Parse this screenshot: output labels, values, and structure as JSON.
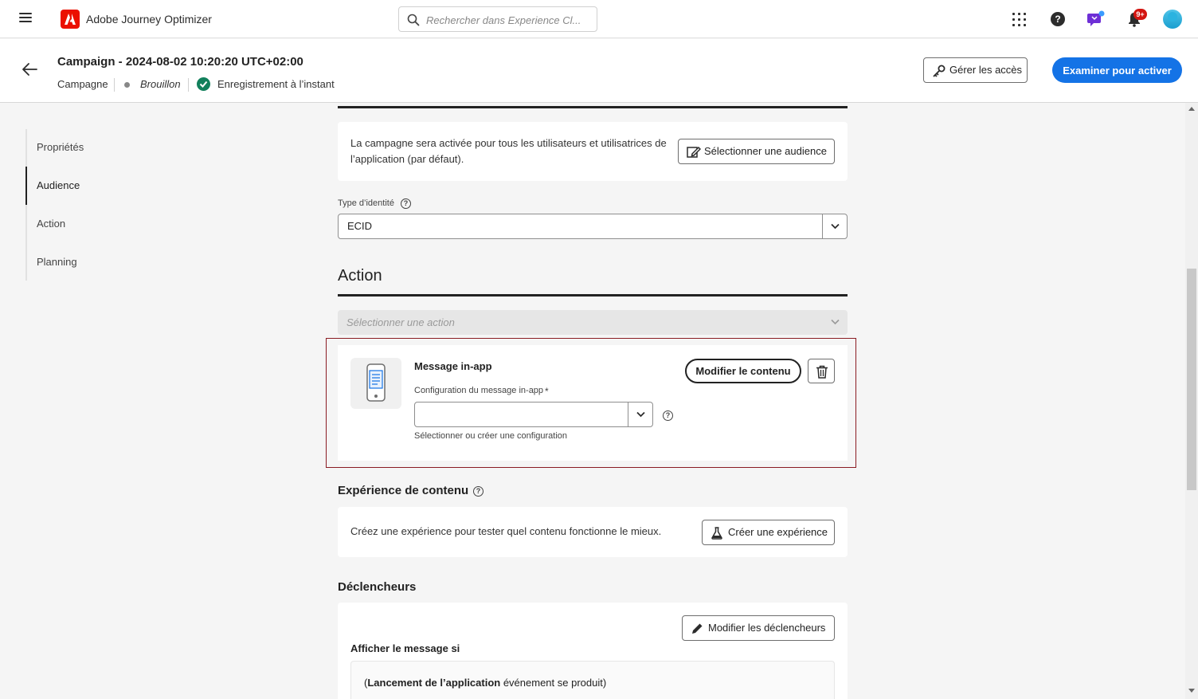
{
  "topbar": {
    "app_title": "Adobe Journey Optimizer",
    "search_placeholder": "Rechercher dans Experience Cl...",
    "notification_badge": "9+"
  },
  "header": {
    "title": "Campaign - 2024-08-02 10:20:20 UTC+02:00",
    "type": "Campagne",
    "status": "Brouillon",
    "save_status": "Enregistrement à l’instant",
    "manage_access_label": "Gérer les accès",
    "review_activate_label": "Examiner pour activer"
  },
  "leftnav": {
    "items": [
      {
        "label": "Propriétés"
      },
      {
        "label": "Audience"
      },
      {
        "label": "Action"
      },
      {
        "label": "Planning"
      }
    ],
    "active": "Audience"
  },
  "audience": {
    "description_line1": "La campagne sera activée pour tous les utilisateurs et utilisatrices de",
    "description_line2": "l’application (par défaut).",
    "select_audience_label": "Sélectionner une audience",
    "identity_type_label": "Type d’identité",
    "identity_type_value": "ECID"
  },
  "action": {
    "title": "Action",
    "select_action_placeholder": "Sélectionner une action",
    "inapp": {
      "title": "Message in-app",
      "config_label": "Configuration du message in-app",
      "required_mark": "*",
      "config_value": "",
      "config_help": "Sélectionner ou créer une configuration",
      "edit_content_label": "Modifier le contenu"
    }
  },
  "content_experience": {
    "title": "Expérience de contenu",
    "description": "Créez une expérience pour tester quel contenu fonctionne le mieux.",
    "create_label": "Créer une expérience"
  },
  "triggers": {
    "title": "Déclencheurs",
    "edit_label": "Modifier les déclencheurs",
    "show_if_label": "Afficher le message si",
    "condition_open": "(",
    "condition_bold": "Lancement de l’application",
    "condition_rest": " événement se produit)"
  },
  "colors": {
    "accent": "#1473e6",
    "highlight_border": "#8a1c23",
    "success": "#12805c",
    "logo": "#eb1000"
  }
}
